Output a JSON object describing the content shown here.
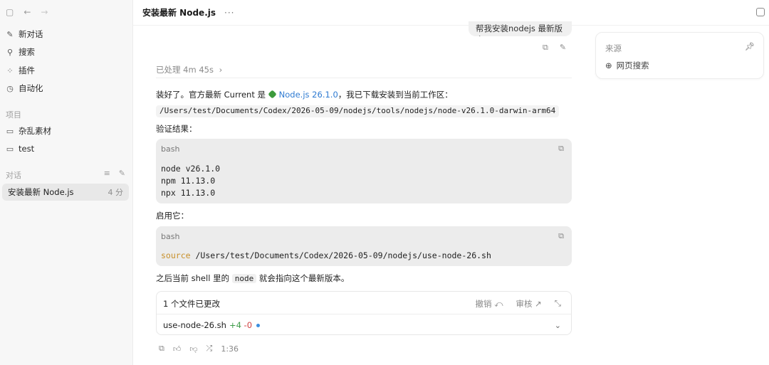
{
  "window": {
    "icons": [
      "sidebar-toggle-icon",
      "back-arrow-icon",
      "forward-arrow-icon"
    ]
  },
  "sidebar": {
    "nav": [
      {
        "icon": "edit-icon",
        "glyph": "✎",
        "label": "新对话"
      },
      {
        "icon": "search-icon",
        "glyph": "⚲",
        "label": "搜索"
      },
      {
        "icon": "plugin-icon",
        "glyph": "⁘",
        "label": "插件"
      },
      {
        "icon": "clock-icon",
        "glyph": "◷",
        "label": "自动化"
      }
    ],
    "projects_label": "项目",
    "projects": [
      {
        "icon": "folder-icon",
        "glyph": "▭",
        "label": "杂乱素材"
      },
      {
        "icon": "folder-gear-icon",
        "glyph": "▭",
        "label": "test"
      }
    ],
    "chats_label": "对话",
    "active_chat": {
      "label": "安装最新 Node.js",
      "time": "4 分"
    }
  },
  "topbar": {
    "title": "安装最新 Node.js",
    "more": "···"
  },
  "conversation": {
    "user_message": "帮我安装nodejs 最新版本",
    "processed": "已处理 4m 45s",
    "intro_prefix": "装好了。官方最新 Current 是 ",
    "intro_link": "Node.js 26.1.0",
    "intro_suffix": "，我已下载安装到当前工作区：",
    "install_path": "/Users/test/Documents/Codex/2026-05-09/nodejs/tools/nodejs/node-v26.1.0-darwin-arm64",
    "verify_label": "验证结果：",
    "code1": {
      "lang": "bash",
      "lines": [
        "node v26.1.0",
        "npm 11.13.0",
        "npx 11.13.0"
      ]
    },
    "enable_label": "启用它：",
    "code2": {
      "lang": "bash",
      "keyword": "source",
      "rest": " /Users/test/Documents/Codex/2026-05-09/nodejs/use-node-26.sh"
    },
    "outro_prefix": "之后当前 shell 里的 ",
    "outro_code": "node",
    "outro_suffix": " 就会指向这个最新版本。",
    "files_card": {
      "title": "1 个文件已更改",
      "undo": "撤销 ⤺",
      "review": "审核 ↗",
      "collapse": "⤡",
      "file": "use-node-26.sh",
      "added": "+4",
      "removed": "-0",
      "chevron": "⌄"
    },
    "footer_time": "1:36"
  },
  "sources": {
    "label": "来源",
    "item": "网页搜索"
  }
}
